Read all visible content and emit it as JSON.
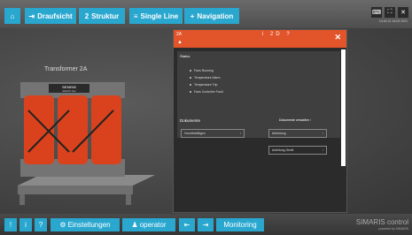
{
  "topbar": {
    "buttons": [
      {
        "icon": "home-icon",
        "label": ""
      },
      {
        "icon": "arrow-right-icon",
        "label": "Draufsicht"
      },
      {
        "icon": "number-icon",
        "label": "Struktur"
      },
      {
        "icon": "single-line-icon",
        "label": "Single Line"
      },
      {
        "icon": "plus-icon",
        "label": "Navigation"
      }
    ],
    "right_icons": [
      "keyboard-icon",
      "fullscreen-icon",
      "close-icon"
    ],
    "clock": "14.04.21  14:03  2021"
  },
  "transformer": {
    "title": "Transformer 2A",
    "brand": "SIEMENS",
    "brand_sub": "GEAFOL Neo",
    "fire_color": "#d9421c"
  },
  "modal": {
    "title": "2A",
    "icons": [
      "i",
      "2D",
      "?"
    ],
    "status": {
      "heading": "Status",
      "items": [
        "Fans Running",
        "Temperature Alarm",
        "Temperature Trip",
        "Fans Controller Fault"
      ]
    },
    "dokumente": {
      "heading": "Dokumente",
      "action": "Dokumente verwalten",
      "buttons": [
        {
          "label": "Vorortbetätigen"
        },
        {
          "label": "Abbildung"
        },
        {
          "label": "Anleitung Gerät"
        }
      ]
    },
    "header_color": "#e2542a"
  },
  "bottombar": {
    "buttons": [
      {
        "icon": "exclamation-icon",
        "label": "!"
      },
      {
        "icon": "info-icon",
        "label": "i"
      },
      {
        "icon": "question-icon",
        "label": "?"
      },
      {
        "icon": "settings-icon",
        "label": "Einstellungen"
      },
      {
        "icon": "user-icon",
        "label": "operator"
      },
      {
        "icon": "back-icon",
        "label": ""
      },
      {
        "icon": "logout-icon",
        "label": ""
      },
      {
        "icon": "monitoring-icon",
        "label": "Monitoring"
      }
    ],
    "brand": "SIMARIS control",
    "brand_sub": "powered by SIMARIS"
  },
  "accent": "#29a7cf"
}
